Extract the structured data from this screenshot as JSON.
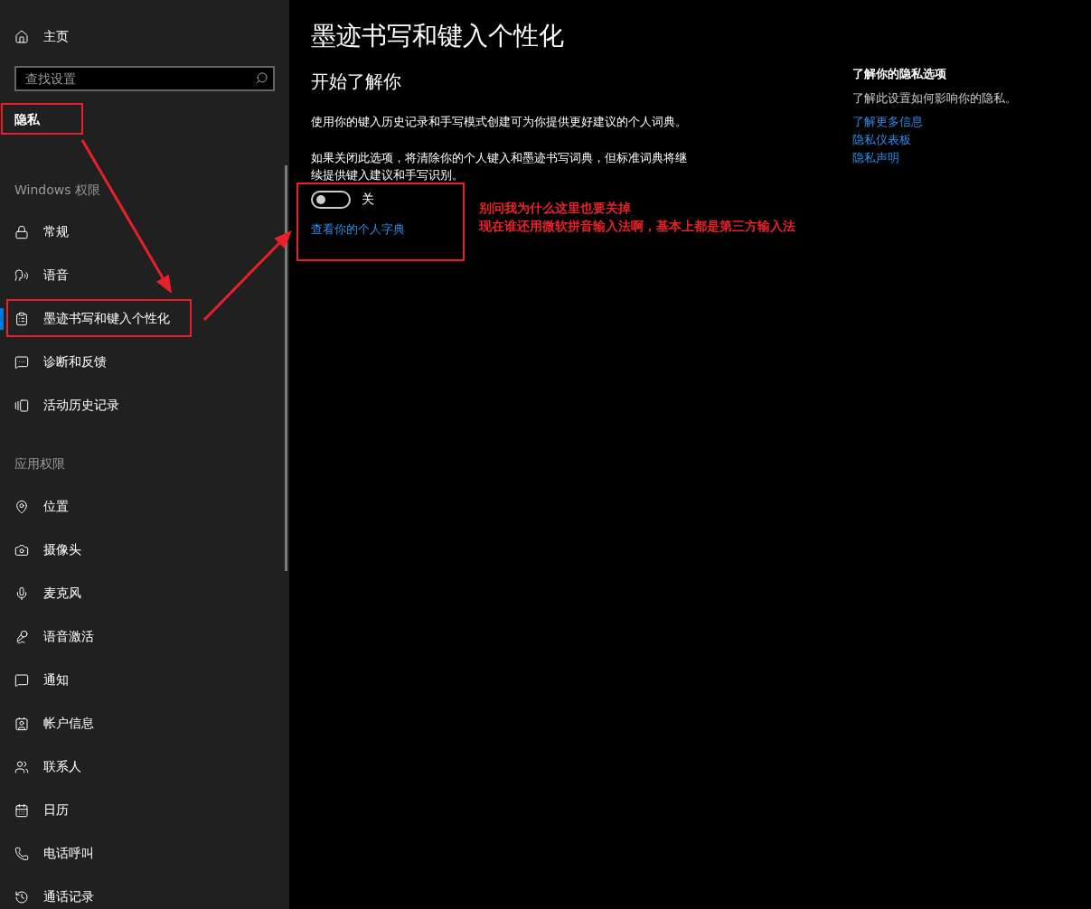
{
  "sidebar": {
    "home": "主页",
    "search": {
      "placeholder": "查找设置"
    },
    "header": "隐私",
    "groups": [
      {
        "label": "Windows 权限",
        "items": [
          {
            "label": "常规",
            "selected": false
          },
          {
            "label": "语音",
            "selected": false
          },
          {
            "label": "墨迹书写和键入个性化",
            "selected": true
          },
          {
            "label": "诊断和反馈",
            "selected": false
          },
          {
            "label": "活动历史记录",
            "selected": false
          }
        ]
      },
      {
        "label": "应用权限",
        "items": [
          {
            "label": "位置",
            "selected": false
          },
          {
            "label": "摄像头",
            "selected": false
          },
          {
            "label": "麦克风",
            "selected": false
          },
          {
            "label": "语音激活",
            "selected": false
          },
          {
            "label": "通知",
            "selected": false
          },
          {
            "label": "帐户信息",
            "selected": false
          },
          {
            "label": "联系人",
            "selected": false
          },
          {
            "label": "日历",
            "selected": false
          },
          {
            "label": "电话呼叫",
            "selected": false
          },
          {
            "label": "通话记录",
            "selected": false
          }
        ]
      }
    ]
  },
  "page": {
    "title": "墨迹书写和键入个性化",
    "section": "开始了解你",
    "description": "使用你的键入历史记录和手写模式创建可为你提供更好建议的个人词典。",
    "note": "如果关闭此选项，将清除你的个人键入和墨迹书写词典，但标准词典将继续提供键入建议和手写识别。",
    "toggle": {
      "on": false,
      "label": "关"
    },
    "link": "查看你的个人字典"
  },
  "aside": {
    "heading": "了解你的隐私选项",
    "text": "了解此设置如何影响你的隐私。",
    "links": [
      "了解更多信息",
      "隐私仪表板",
      "隐私声明"
    ]
  },
  "annotation": {
    "lines": [
      "别问我为什么这里也要关掉",
      "现在谁还用微软拼音输入法啊，基本上都是第三方输入法"
    ]
  }
}
